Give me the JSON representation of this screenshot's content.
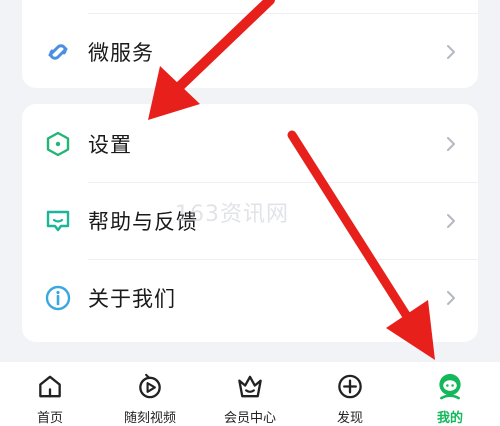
{
  "menu": {
    "top_item": {
      "label": "微服务",
      "icon": "link-icon"
    },
    "items": [
      {
        "label": "设置",
        "icon": "hexagon-settings-icon"
      },
      {
        "label": "帮助与反馈",
        "icon": "chat-help-icon"
      },
      {
        "label": "关于我们",
        "icon": "info-icon"
      }
    ]
  },
  "watermark": "163资讯网",
  "tabbar": {
    "tabs": [
      {
        "label": "首页",
        "icon": "home-icon"
      },
      {
        "label": "随刻视频",
        "icon": "video-play-icon"
      },
      {
        "label": "会员中心",
        "icon": "crown-basket-icon"
      },
      {
        "label": "发现",
        "icon": "plus-circle-icon"
      },
      {
        "label": "我的",
        "icon": "profile-icon"
      }
    ],
    "active_index": 4
  },
  "colors": {
    "accent_green": "#12b85a",
    "annotation_red": "#e8201c",
    "background": "#f2f3f7"
  }
}
